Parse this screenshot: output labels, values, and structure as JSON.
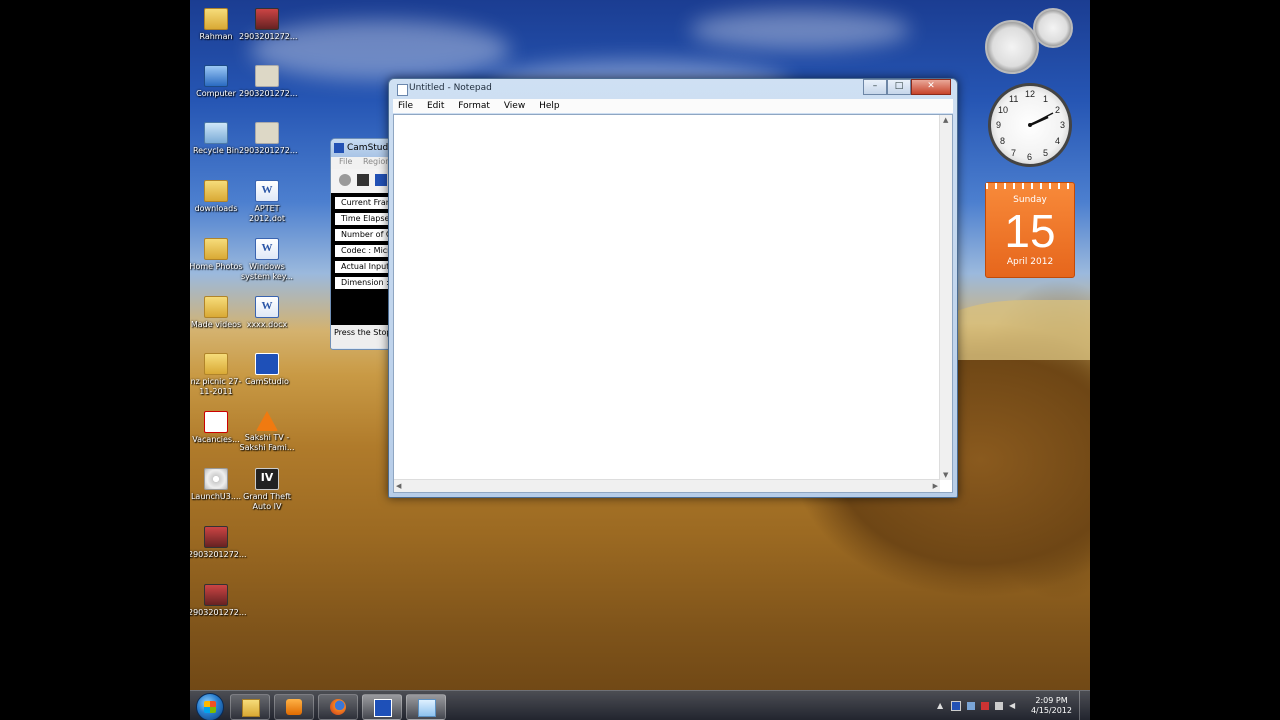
{
  "desktop": {
    "icons_left": [
      {
        "label": "Rahman",
        "icon": "folder-icon"
      },
      {
        "label": "Computer",
        "icon": "computer-icon"
      },
      {
        "label": "Recycle Bin",
        "icon": "recycle-bin-icon"
      },
      {
        "label": "downloads",
        "icon": "folder-icon"
      },
      {
        "label": "Home Photos",
        "icon": "folder-icon"
      },
      {
        "label": "Made videos",
        "icon": "folder-icon"
      },
      {
        "label": "nz picnic 27-11-2011",
        "icon": "folder-icon"
      },
      {
        "label": "Vacancies...",
        "icon": "pdf-icon"
      },
      {
        "label": "LaunchU3....",
        "icon": "cd-icon"
      },
      {
        "label": "2903201272...",
        "icon": "image-icon"
      },
      {
        "label": "2903201272...",
        "icon": "image-icon"
      }
    ],
    "icons_right": [
      {
        "label": "2903201272...",
        "icon": "image-icon"
      },
      {
        "label": "2903201272...",
        "icon": "photo-icon"
      },
      {
        "label": "2903201272...",
        "icon": "photo-icon"
      },
      {
        "label": "APTET 2012.dot",
        "icon": "word-icon"
      },
      {
        "label": "Windows system key...",
        "icon": "word-icon"
      },
      {
        "label": "xxxx.docx",
        "icon": "word-icon"
      },
      {
        "label": "CamStudio",
        "icon": "camstudio-icon"
      },
      {
        "label": "Sakshi TV - Sakshi Fami...",
        "icon": "vlc-icon"
      },
      {
        "label": "Grand Theft Auto IV",
        "icon": "gta-icon"
      }
    ]
  },
  "gadgets": {
    "calendar": {
      "day": "Sunday",
      "date": "15",
      "month": "April 2012"
    },
    "clock": {
      "numerals": [
        "12",
        "3",
        "6",
        "9",
        "1",
        "2",
        "4",
        "5",
        "7",
        "8",
        "10",
        "11"
      ]
    }
  },
  "camstudio": {
    "title": "CamStudio",
    "menu": [
      "File",
      "Region"
    ],
    "rows": [
      "Current Frame",
      "Time Elapsed",
      "Number of Co",
      "Codec : Micro",
      "Actual Input R",
      "Dimension : "
    ],
    "status": "Press the Stop"
  },
  "notepad": {
    "title": "Untitled - Notepad",
    "menu": [
      "File",
      "Edit",
      "Format",
      "View",
      "Help"
    ],
    "content": "",
    "controls": {
      "minimize": "–",
      "maximize": "□",
      "close": "✕"
    }
  },
  "taskbar": {
    "pinned": [
      {
        "name": "explorer",
        "icon": "folder-icon"
      },
      {
        "name": "media-player",
        "icon": "media-player-icon"
      },
      {
        "name": "firefox",
        "icon": "firefox-icon"
      },
      {
        "name": "camstudio",
        "icon": "camstudio-icon"
      },
      {
        "name": "notepad",
        "icon": "notepad-icon"
      }
    ],
    "time": "2:09 PM",
    "date": "4/15/2012"
  }
}
